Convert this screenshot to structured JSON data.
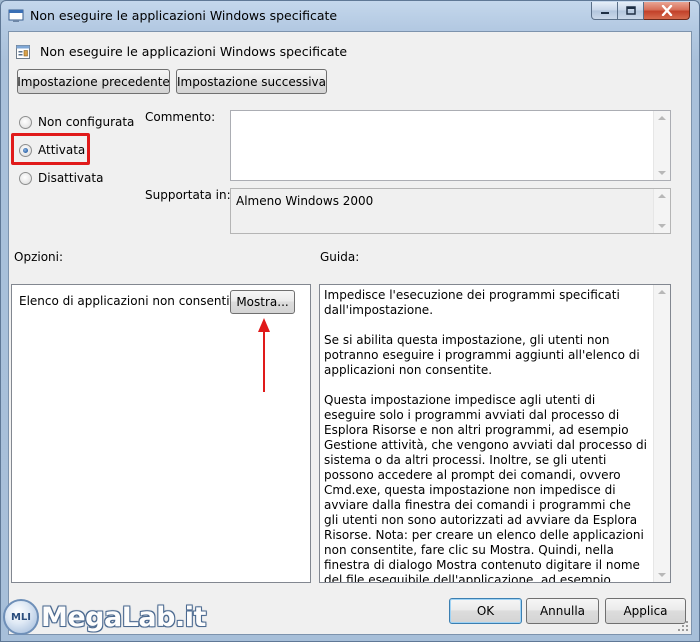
{
  "window": {
    "title": "Non eseguire le applicazioni Windows specificate"
  },
  "header": {
    "title": "Non eseguire le applicazioni Windows specificate"
  },
  "nav": {
    "previous_label": "Impostazione precedente",
    "next_label": "Impostazione successiva"
  },
  "state": {
    "options": [
      {
        "label": "Non configurata",
        "checked": false
      },
      {
        "label": "Attivata",
        "checked": true
      },
      {
        "label": "Disattivata",
        "checked": false
      }
    ]
  },
  "comment": {
    "label": "Commento:",
    "value": ""
  },
  "supported": {
    "label": "Supportata in:",
    "value": "Almeno Windows 2000"
  },
  "options_panel": {
    "label": "Opzioni:",
    "item_label": "Elenco di applicazioni non consentite",
    "show_button": "Mostra..."
  },
  "help": {
    "label": "Guida:",
    "paragraphs": [
      "Impedisce l'esecuzione dei programmi specificati dall'impostazione.",
      "Se si abilita questa impostazione, gli utenti non potranno eseguire i programmi aggiunti all'elenco di applicazioni non consentite.",
      "Questa impostazione impedisce agli utenti di eseguire solo i programmi avviati dal processo di Esplora Risorse e non altri programmi, ad esempio Gestione attività, che vengono avviati dal processo di sistema o da altri processi. Inoltre, se gli utenti possono accedere al prompt dei comandi, ovvero Cmd.exe, questa impostazione non impedisce di avviare dalla finestra dei comandi i programmi che gli utenti non sono autorizzati ad avviare da Esplora Risorse. Nota: per creare un elenco delle applicazioni non consentite, fare clic su Mostra. Quindi, nella finestra di dialogo Mostra contenuto digitare il nome del file eseguibile dell'applicazione, ad esempio Winword.exe, Poledit.exe, Powerpnt.exe, nella colonna Valore."
    ]
  },
  "footer": {
    "ok_label": "OK",
    "cancel_label": "Annulla",
    "apply_label": "Applica"
  },
  "watermark": {
    "badge": "MLI",
    "text": "MegaLab.it"
  },
  "colors": {
    "highlight": "#e01a1a",
    "radio_dot": "#2b62a8"
  }
}
